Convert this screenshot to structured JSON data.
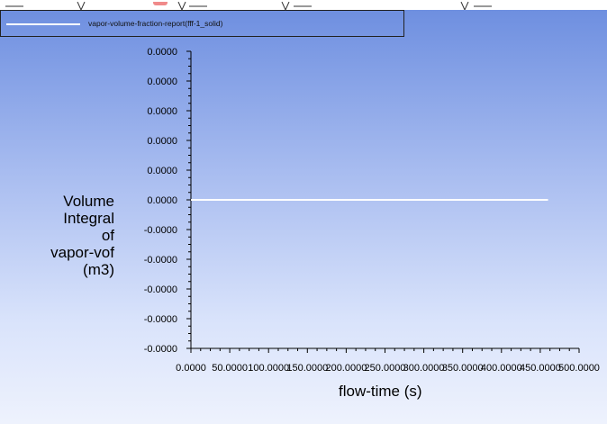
{
  "chart_data": {
    "type": "line",
    "title": "",
    "series": [
      {
        "name": "vapor-volume-fraction-report(fff-1_solid)",
        "color": "#ffffff",
        "x": [
          0,
          460
        ],
        "y": [
          0,
          0
        ]
      }
    ],
    "xlabel": "flow-time (s)",
    "ylabel_lines": [
      "Volume",
      "Integral",
      "of",
      "vapor-vof",
      "(m3)"
    ],
    "xlim": [
      0,
      500
    ],
    "ylim": [
      -5e-05,
      5e-05
    ],
    "x_ticks": [
      {
        "value": 0,
        "label": "0.0000"
      },
      {
        "value": 50,
        "label": "50.0000"
      },
      {
        "value": 100,
        "label": "100.0000"
      },
      {
        "value": 150,
        "label": "150.0000"
      },
      {
        "value": 200,
        "label": "200.0000"
      },
      {
        "value": 250,
        "label": "250.0000"
      },
      {
        "value": 300,
        "label": "300.0000"
      },
      {
        "value": 350,
        "label": "350.0000"
      },
      {
        "value": 400,
        "label": "400.0000"
      },
      {
        "value": 450,
        "label": "450.0000"
      },
      {
        "value": 500,
        "label": "500.0000"
      }
    ],
    "y_ticks": [
      {
        "value": 5e-05,
        "label": "0.0000"
      },
      {
        "value": 4e-05,
        "label": "0.0000"
      },
      {
        "value": 3e-05,
        "label": "0.0000"
      },
      {
        "value": 2e-05,
        "label": "0.0000"
      },
      {
        "value": 1e-05,
        "label": "0.0000"
      },
      {
        "value": 0,
        "label": "0.0000"
      },
      {
        "value": -1e-05,
        "label": "-0.0000"
      },
      {
        "value": -2e-05,
        "label": "-0.0000"
      },
      {
        "value": -3e-05,
        "label": "-0.0000"
      },
      {
        "value": -4e-05,
        "label": "-0.0000"
      },
      {
        "value": -5e-05,
        "label": "-0.0000"
      }
    ],
    "grid": false,
    "legend_position": "top-left"
  }
}
